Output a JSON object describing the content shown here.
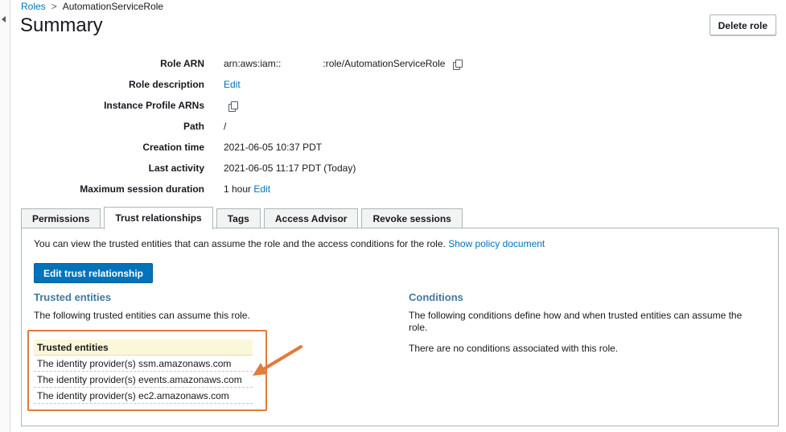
{
  "breadcrumb": {
    "root": "Roles",
    "separator": ">",
    "current": "AutomationServiceRole"
  },
  "page": {
    "title": "Summary",
    "delete_label": "Delete role"
  },
  "summary": {
    "role_arn": {
      "label": "Role ARN",
      "prefix": "arn:aws:iam::",
      "suffix": ":role/AutomationServiceRole"
    },
    "role_description": {
      "label": "Role description",
      "link": "Edit"
    },
    "instance_profile": {
      "label": "Instance Profile ARNs"
    },
    "path": {
      "label": "Path",
      "value": "/"
    },
    "creation_time": {
      "label": "Creation time",
      "value": "2021-06-05 10:37 PDT"
    },
    "last_activity": {
      "label": "Last activity",
      "value": "2021-06-05 11:17 PDT (Today)"
    },
    "max_session": {
      "label": "Maximum session duration",
      "value": "1 hour",
      "link": "Edit"
    }
  },
  "tabs": [
    "Permissions",
    "Trust relationships",
    "Tags",
    "Access Advisor",
    "Revoke sessions"
  ],
  "active_tab": "Trust relationships",
  "trust": {
    "intro": "You can view the trusted entities that can assume the role and the access conditions for the role.",
    "show_policy_link": "Show policy document",
    "edit_button": "Edit trust relationship",
    "entities_heading": "Trusted entities",
    "entities_desc": "The following trusted entities can assume this role.",
    "table_header": "Trusted entities",
    "rows": [
      "The identity provider(s) ssm.amazonaws.com",
      "The identity provider(s) events.amazonaws.com",
      "The identity provider(s) ec2.amazonaws.com"
    ],
    "conditions_heading": "Conditions",
    "conditions_desc": "The following conditions define how and when trusted entities can assume the role.",
    "conditions_none": "There are no conditions associated with this role."
  },
  "colors": {
    "link": "#0073bb",
    "primary_button": "#0073bb",
    "section_heading": "#44799f",
    "annotation": "#e07b3c",
    "table_header_bg": "#fbf7d9"
  },
  "icons": {
    "copy": "copy-icon",
    "collapse": "caret-left-icon",
    "annotation": "arrow-icon"
  }
}
